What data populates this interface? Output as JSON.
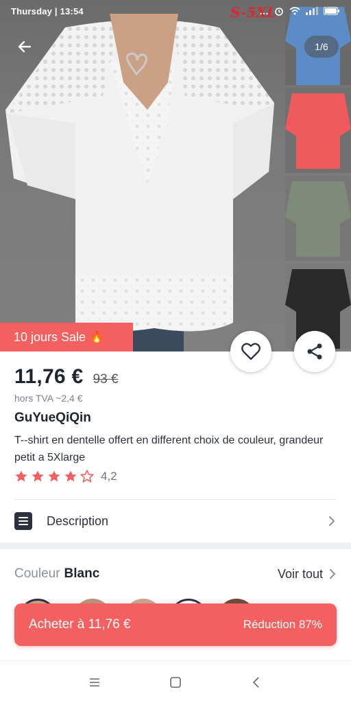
{
  "status_bar": {
    "time": "Thursday | 13:54",
    "icons": [
      "more-dots-icon",
      "alarm-icon",
      "wifi-icon",
      "signal-icon",
      "battery-icon"
    ]
  },
  "hero": {
    "image_overlay_text": "S-5XL",
    "image_counter": "1/6",
    "sale_badge": "10 jours Sale",
    "thumbnail_colors": [
      "#5b8cc6",
      "#ef5b5d",
      "#7f8a7a",
      "#2a2a2a"
    ]
  },
  "product": {
    "price": "11,76 €",
    "old_price": "93 €",
    "tax_note": "hors TVA ~2,4 €",
    "brand": "GuYueQiQin",
    "title": "T--shirt en dentelle offert en different choix de couleur, grandeur petit a 5Xlarge",
    "rating": 4.2,
    "rating_text": "4,2",
    "stars_filled": 4,
    "stars_total": 5
  },
  "description": {
    "label": "Description"
  },
  "color": {
    "label": "Couleur",
    "value": "Blanc",
    "see_all": "Voir tout"
  },
  "buy": {
    "label": "Acheter à 11,76 €",
    "discount": "Réduction 87%"
  },
  "colors": {
    "accent": "#f4605f",
    "star": "#f4605f",
    "text_dark": "#1f2430"
  }
}
